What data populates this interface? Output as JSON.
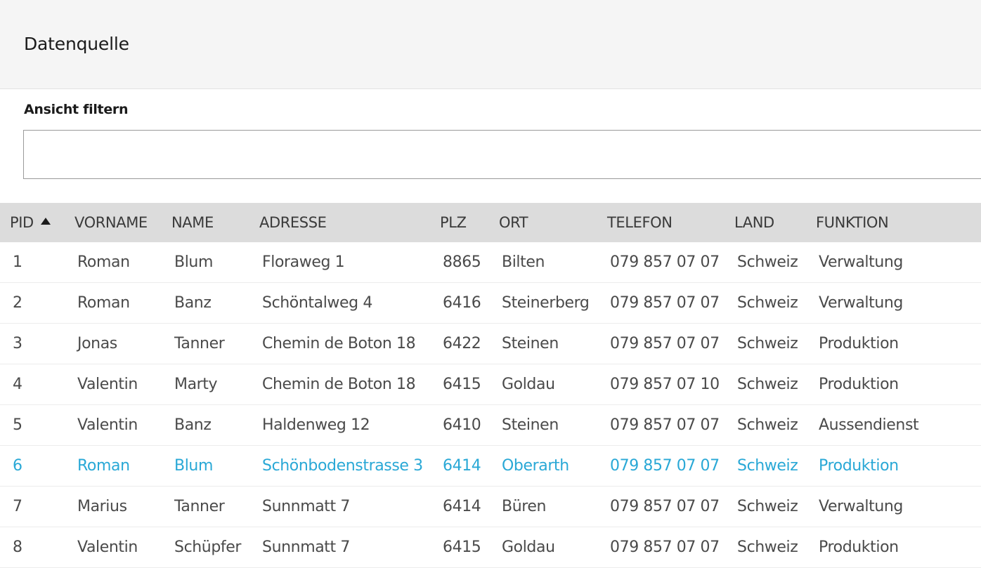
{
  "header": {
    "title": "Datenquelle"
  },
  "filter": {
    "label": "Ansicht filtern",
    "value": "",
    "placeholder": ""
  },
  "table": {
    "columns": {
      "pid": "PID",
      "vorname": "VORNAME",
      "name": "NAME",
      "adresse": "ADRESSE",
      "plz": "PLZ",
      "ort": "ORT",
      "telefon": "TELEFON",
      "land": "LAND",
      "funktion": "FUNKTION"
    },
    "sort": {
      "column": "pid",
      "direction": "ascending",
      "icon": "sort-up-icon"
    },
    "selected_row": 6,
    "selected_color": "#29a8d6",
    "rows": [
      {
        "pid": "1",
        "vorname": "Roman",
        "name": "Blum",
        "adresse": "Floraweg 1",
        "plz": "8865",
        "ort": "Bilten",
        "telefon": "079 857 07 07",
        "land": "Schweiz",
        "funktion": "Verwaltung"
      },
      {
        "pid": "2",
        "vorname": "Roman",
        "name": "Banz",
        "adresse": "Schöntalweg 4",
        "plz": "6416",
        "ort": "Steinerberg",
        "telefon": "079 857 07 07",
        "land": "Schweiz",
        "funktion": "Verwaltung"
      },
      {
        "pid": "3",
        "vorname": "Jonas",
        "name": "Tanner",
        "adresse": "Chemin de Boton 18",
        "plz": "6422",
        "ort": "Steinen",
        "telefon": "079 857 07 07",
        "land": "Schweiz",
        "funktion": "Produktion"
      },
      {
        "pid": "4",
        "vorname": "Valentin",
        "name": "Marty",
        "adresse": "Chemin de Boton 18",
        "plz": "6415",
        "ort": "Goldau",
        "telefon": "079 857 07 10",
        "land": "Schweiz",
        "funktion": "Produktion"
      },
      {
        "pid": "5",
        "vorname": "Valentin",
        "name": "Banz",
        "adresse": "Haldenweg 12",
        "plz": "6410",
        "ort": "Steinen",
        "telefon": "079 857 07 07",
        "land": "Schweiz",
        "funktion": "Aussendienst"
      },
      {
        "pid": "6",
        "vorname": "Roman",
        "name": "Blum",
        "adresse": "Schönbodenstrasse 3",
        "plz": "6414",
        "ort": "Oberarth",
        "telefon": "079 857 07 07",
        "land": "Schweiz",
        "funktion": "Produktion"
      },
      {
        "pid": "7",
        "vorname": "Marius",
        "name": "Tanner",
        "adresse": "Sunnmatt 7",
        "plz": "6414",
        "ort": "Büren",
        "telefon": "079 857 07 07",
        "land": "Schweiz",
        "funktion": "Verwaltung"
      },
      {
        "pid": "8",
        "vorname": "Valentin",
        "name": "Schüpfer",
        "adresse": "Sunnmatt 7",
        "plz": "6415",
        "ort": "Goldau",
        "telefon": "079 857 07 07",
        "land": "Schweiz",
        "funktion": "Produktion"
      }
    ]
  }
}
